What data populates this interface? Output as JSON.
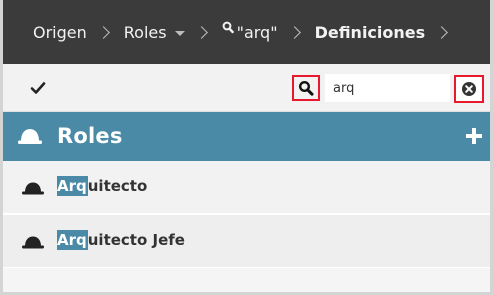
{
  "breadcrumb": {
    "items": [
      {
        "label": "Origen"
      },
      {
        "label": "Roles"
      },
      {
        "label": "\"arq\""
      },
      {
        "label": "Definiciones"
      }
    ]
  },
  "toolbar": {
    "search_value": "arq"
  },
  "header": {
    "title": "Roles"
  },
  "list": {
    "items": [
      {
        "match": "Arq",
        "rest": "uitecto"
      },
      {
        "match": "Arq",
        "rest": "uitecto Jefe"
      }
    ]
  },
  "colors": {
    "breadcrumb_bg": "#3b3b3b",
    "header_bg": "#4a8aa6",
    "highlight": "#e8192c"
  },
  "icons": {
    "check": "check-icon",
    "search": "search-icon",
    "clear": "clear-circle-x-icon",
    "add": "plus-icon",
    "role": "hard-hat-icon"
  }
}
